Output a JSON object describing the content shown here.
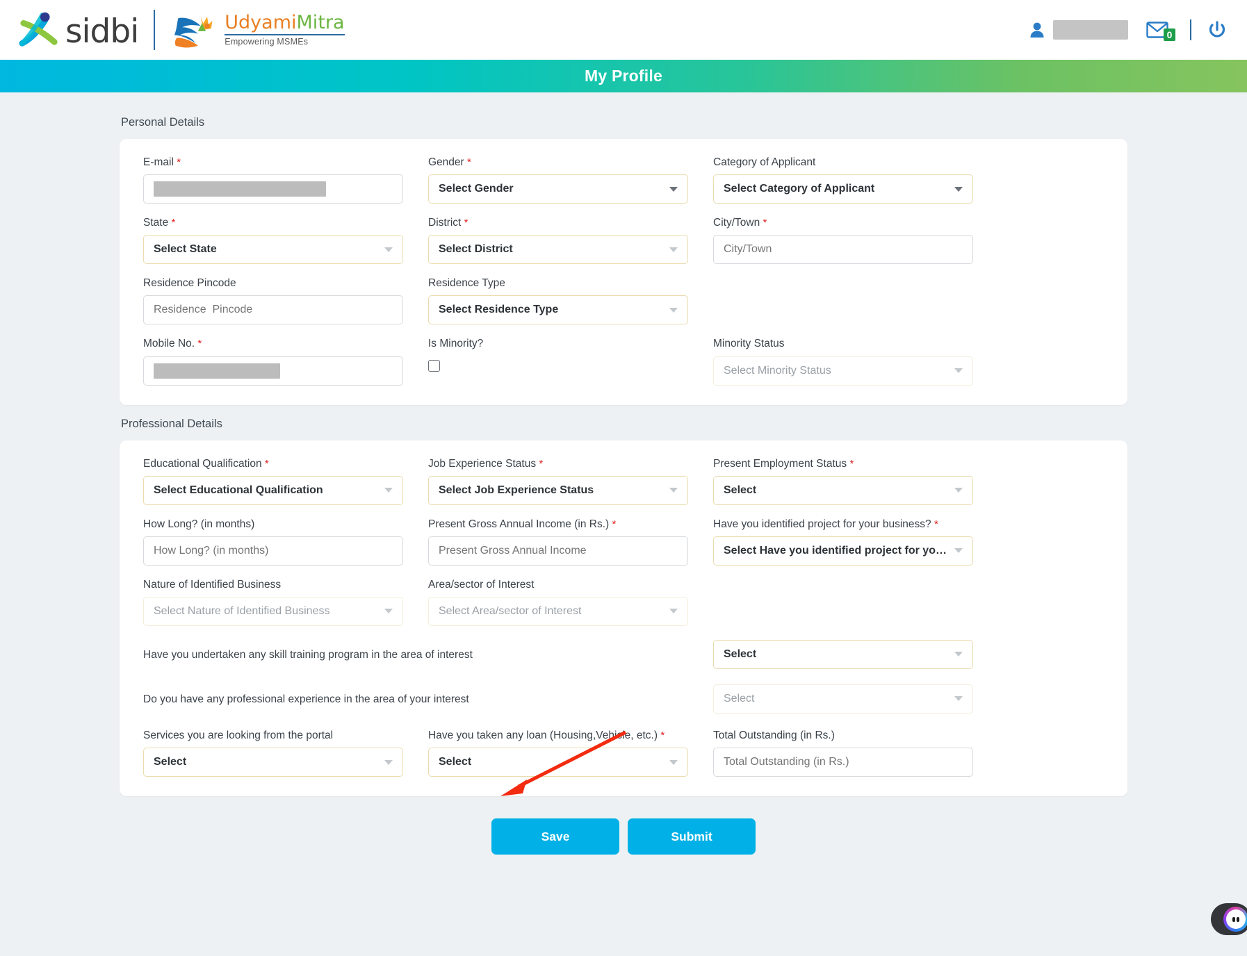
{
  "header": {
    "brand_sidbi": "sidbi",
    "brand_udyami_a": "Udyami",
    "brand_udyami_b": "Mitra",
    "brand_tagline": "Empowering MSMEs",
    "user_name_redacted": "",
    "mail_badge_count": "0",
    "icons": {
      "person": "person-icon",
      "mail": "mail-icon",
      "power": "power-icon"
    }
  },
  "page_title": "My Profile",
  "personal": {
    "section_label": "Personal Details",
    "email_label": "E-mail",
    "email_value_redacted": "",
    "gender_label": "Gender",
    "gender_value": "Select Gender",
    "category_label": "Category of Applicant",
    "category_value": "Select Category of Applicant",
    "state_label": "State",
    "state_value": "Select State",
    "district_label": "District",
    "district_value": "Select District",
    "city_label": "City/Town",
    "city_placeholder": "City/Town",
    "pincode_label": "Residence Pincode",
    "pincode_placeholder": "Residence  Pincode",
    "residence_type_label": "Residence Type",
    "residence_type_value": "Select Residence Type",
    "mobile_label": "Mobile No.",
    "mobile_value_redacted": "",
    "is_minority_label": "Is Minority?",
    "minority_status_label": "Minority Status",
    "minority_status_value": "Select Minority Status"
  },
  "professional": {
    "section_label": "Professional Details",
    "edu_label": "Educational Qualification",
    "edu_value": "Select Educational Qualification",
    "job_exp_label": "Job Experience Status",
    "job_exp_value": "Select Job Experience Status",
    "employment_label": "Present Employment Status",
    "employment_value": "Select",
    "howlong_label": "How Long? (in months)",
    "howlong_placeholder": "How Long? (in months)",
    "income_label": "Present Gross Annual Income (in Rs.)",
    "income_placeholder": "Present Gross Annual Income",
    "identified_project_label": "Have you identified project for your business?",
    "identified_project_value": "Select Have you identified project for your bu…",
    "nature_label": "Nature of Identified Business",
    "nature_value": "Select Nature of Identified Business",
    "area_label": "Area/sector of Interest",
    "area_value": "Select Area/sector of Interest",
    "skill_training_question": "Have you undertaken any skill training program in the area of interest",
    "skill_training_value": "Select",
    "prof_experience_question": "Do you have any professional experience in the area of your interest",
    "prof_experience_value": "Select",
    "services_label": "Services you are looking from the portal",
    "services_value": "Select",
    "loan_label": "Have you taken any loan (Housing,Vehicle, etc.)",
    "loan_value": "Select",
    "outstanding_label": "Total Outstanding (in Rs.)",
    "outstanding_placeholder": "Total Outstanding (in Rs.)"
  },
  "actions": {
    "save_label": "Save",
    "submit_label": "Submit"
  },
  "colors": {
    "accent_button": "#00b0e6",
    "required_asterisk": "#e02020",
    "badge_green": "#1e9e4a",
    "annotation_arrow": "#f32b10",
    "bar_gradient_start": "#00b8e0",
    "bar_gradient_end": "#86c45e"
  },
  "required_mark": "*"
}
